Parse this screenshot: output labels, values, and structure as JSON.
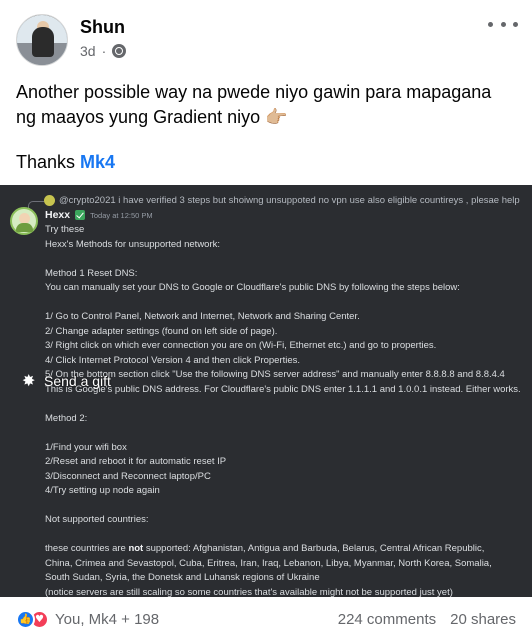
{
  "post": {
    "author": "Shun",
    "time": "3d",
    "text_line1": "Another possible way na pwede niyo gawin para mapagana",
    "text_line2": "ng maayos yung Gradient niyo",
    "text_emoji": "👉🏼",
    "thanks_prefix": "Thanks ",
    "thanks_mention": "Mk4"
  },
  "discord": {
    "reply_text": "@crypto2021 i have verified 3 steps but shoiwng unsuppoted no vpn use also eligible countireys , plesae help",
    "name": "Hexx",
    "timestamp": "Today at 12:50 PM",
    "lines": [
      "Try these",
      "Hexx's Methods for unsupported network:",
      "",
      "Method 1 Reset DNS:",
      "You can manually set your DNS to Google or Cloudflare's public DNS by following the steps below:",
      "",
      "1/ Go to Control Panel, Network and Internet, Network and Sharing Center.",
      "2/ Change adapter settings (found on left side of page).",
      "3/ Right click on which ever connection you are on (Wi-Fi, Ethernet etc.) and go to properties.",
      "4/ Click Internet Protocol Version 4 and then click Properties.",
      "5/ On the bottom section click \"Use the following DNS server address\" and manually enter 8.8.8.8 and 8.8.4.4",
      "This is Google's public DNS address. For Cloudflare's public DNS enter 1.1.1.1 and 1.0.0.1 instead. Either works.",
      "",
      "Method 2:",
      "",
      "1/Find your wifi box",
      "2/Reset and reboot it for automatic reset IP",
      "3/Disconnect and Reconnect laptop/PC",
      "4/Try setting up node again",
      "",
      "Not supported countries:",
      ""
    ],
    "countries_pre": "these countries are ",
    "countries_bold": "not",
    "countries_post": " supported: Afghanistan, Antigua and Barbuda, Belarus, Central African Republic,",
    "countries_line2": "China, Crimea and Sevastopol, Cuba, Eritrea, Iran, Iraq, Lebanon, Libya, Myanmar, North Korea, Somalia,",
    "countries_line3": "South Sudan, Syria, the Donetsk and Luhansk regions of Ukraine",
    "countries_line4": "(notice servers are still scaling so some countries that's available might not be supported just yet)"
  },
  "gift": {
    "label": "Send a gift"
  },
  "footer": {
    "reactions": "You, Mk4 + 198",
    "comments": "224 comments",
    "shares": "20 shares"
  }
}
